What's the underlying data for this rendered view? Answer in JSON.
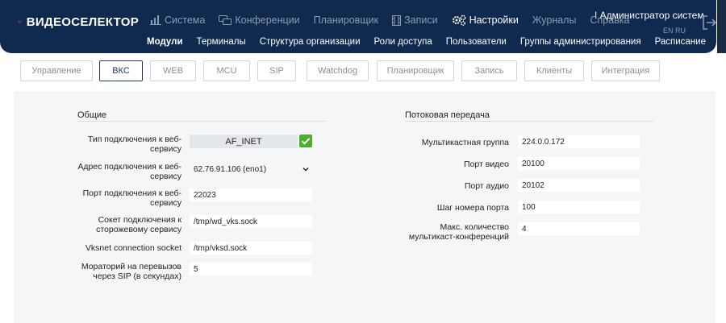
{
  "header": {
    "logo_text": "ВИДЕОСЕЛЕКТОР",
    "nav": [
      {
        "label": "Система",
        "icon": "chart-icon"
      },
      {
        "label": "Конференции",
        "icon": "chat-icon"
      },
      {
        "label": "Планировщик",
        "icon": ""
      },
      {
        "label": "Записи",
        "icon": "film-icon"
      },
      {
        "label": "Настройки",
        "icon": "gears-icon"
      },
      {
        "label": "Журналы",
        "icon": ""
      },
      {
        "label": "Справка",
        "icon": ""
      }
    ],
    "user": "! Администратор систем",
    "lang": "EN RU",
    "subnav": [
      "Модули",
      "Терминалы",
      "Структура организации",
      "Роли доступа",
      "Пользователи",
      "Группы администрирования",
      "Расписание"
    ]
  },
  "tabs": [
    "Управление",
    "ВКС",
    "WEB",
    "MCU",
    "SIP",
    "Watchdog",
    "Планировщик",
    "Запись",
    "Клиенты",
    "Интеграция"
  ],
  "general": {
    "title": "Общие",
    "connection_type_label": "Тип подключения к веб-сервису",
    "connection_type_value": "AF_INET",
    "address_label": "Адрес подключения к веб-сервису",
    "address_value": "62.76.91.106 (eno1)",
    "port_label": "Порт подключения к веб-сервису",
    "port_value": "22023",
    "socket_label": "Сокет подключения к сторожевому сервису",
    "socket_value": "/tmp/wd_vks.sock",
    "vksnet_label": "Vksnet connection socket",
    "vksnet_value": "/tmp/vksd.sock",
    "moratorium_label": "Мораторий на перевызов через SIP (в секундах)",
    "moratorium_value": "5"
  },
  "streaming": {
    "title": "Потоковая передача",
    "multicast_label": "Мультикастная группа",
    "multicast_value": "224.0.0.172",
    "video_port_label": "Порт видео",
    "video_port_value": "20100",
    "audio_port_label": "Порт аудио",
    "audio_port_value": "20102",
    "port_step_label": "Шаг номера порта",
    "port_step_value": "100",
    "max_conf_label": "Макс. количество мультикаст-конференций",
    "max_conf_value": "4"
  },
  "colors": {
    "header": "#0f2a4e",
    "accent": "#1e3a66",
    "check": "#4caf2a",
    "logo": "#e8473c"
  }
}
